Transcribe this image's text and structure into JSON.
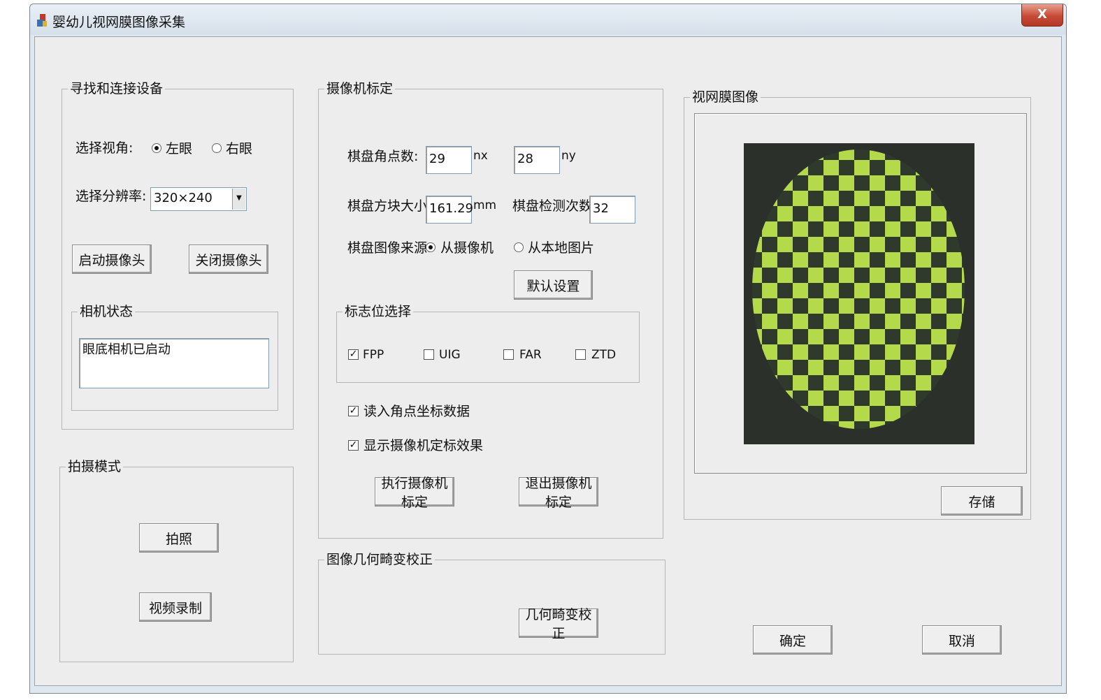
{
  "window": {
    "title": "婴幼儿视网膜图像采集",
    "close_label": "X"
  },
  "device_group": {
    "title": "寻找和连接设备",
    "view_label": "选择视角:",
    "left_eye": "左眼",
    "right_eye": "右眼",
    "selected_eye": "left",
    "resolution_label": "选择分辨率:",
    "resolution_value": "320×240",
    "start_camera": "启动摄像头",
    "close_camera": "关闭摄像头",
    "status_group_title": "相机状态",
    "status_text": "眼底相机已启动"
  },
  "shoot_group": {
    "title": "拍摄模式",
    "photo": "拍照",
    "video": "视频录制"
  },
  "calibration": {
    "title": "摄像机标定",
    "corners_label": "棋盘角点数:",
    "nx_value": "29",
    "nx_unit": "nx",
    "ny_value": "28",
    "ny_unit": "ny",
    "square_label": "棋盘方块大小:",
    "square_value": "161.29",
    "square_unit": "mm",
    "detect_label": "棋盘检测次数:",
    "detect_value": "32",
    "source_label": "棋盘图像来源:",
    "source_camera": "从摄像机",
    "source_local": "从本地图片",
    "default_button": "默认设置",
    "flags_title": "标志位选择",
    "flags": [
      {
        "label": "FPP",
        "checked": true
      },
      {
        "label": "UIG",
        "checked": false
      },
      {
        "label": "FAR",
        "checked": false
      },
      {
        "label": "ZTD",
        "checked": false
      }
    ],
    "read_corners": "读入角点坐标数据",
    "show_effect": "显示摄像机定标效果",
    "run_button": "执行摄像机标定",
    "exit_button": "退出摄像机标定"
  },
  "distortion": {
    "title": "图像几何畸变校正",
    "button": "几何畸变校正"
  },
  "retina": {
    "title": "视网膜图像",
    "save_button": "存储"
  },
  "footer": {
    "ok": "确定",
    "cancel": "取消"
  },
  "colors": {
    "checker_light": "#b4d94a",
    "checker_dark": "#2f3a2c",
    "image_bg": "#2a2f2a"
  }
}
